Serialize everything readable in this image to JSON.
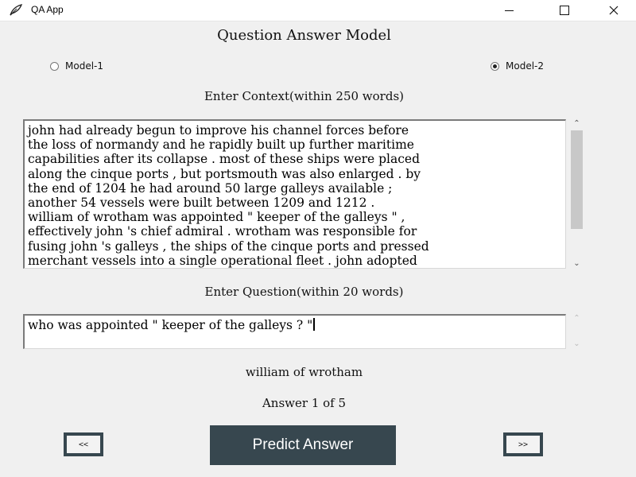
{
  "window": {
    "title": "QA App",
    "icon": "feather-app-icon"
  },
  "heading": "Question Answer Model",
  "models": [
    {
      "label": "Model-1",
      "selected": false
    },
    {
      "label": "Model-2",
      "selected": true
    }
  ],
  "context": {
    "label": "Enter Context(within 250 words)",
    "lines": [
      "john had already begun to improve his channel forces before",
      "the loss of normandy and he rapidly built up further maritime",
      "capabilities after its collapse . most of these ships were placed",
      "along the cinque ports , but portsmouth was also enlarged . by",
      "the end of 1204 he had around 50 large galleys available ;",
      "another 54 vessels were built between 1209 and 1212 .",
      "william of wrotham was appointed \" keeper of the galleys \" ,",
      "effectively john 's chief admiral . wrotham was responsible for",
      "fusing john 's galleys , the ships of the cinque ports and pressed",
      "merchant vessels into a single operational fleet . john adopted"
    ]
  },
  "question": {
    "label": "Enter Question(within 20 words)",
    "value": "who was appointed \" keeper of the galleys ? \""
  },
  "answer": {
    "text": "william of wrotham",
    "counter": "Answer 1 of 5"
  },
  "buttons": {
    "prev": "<<",
    "predict": "Predict Answer",
    "next": ">>"
  },
  "colors": {
    "button_bg": "#37474f",
    "window_bg": "#f0f0f0"
  }
}
